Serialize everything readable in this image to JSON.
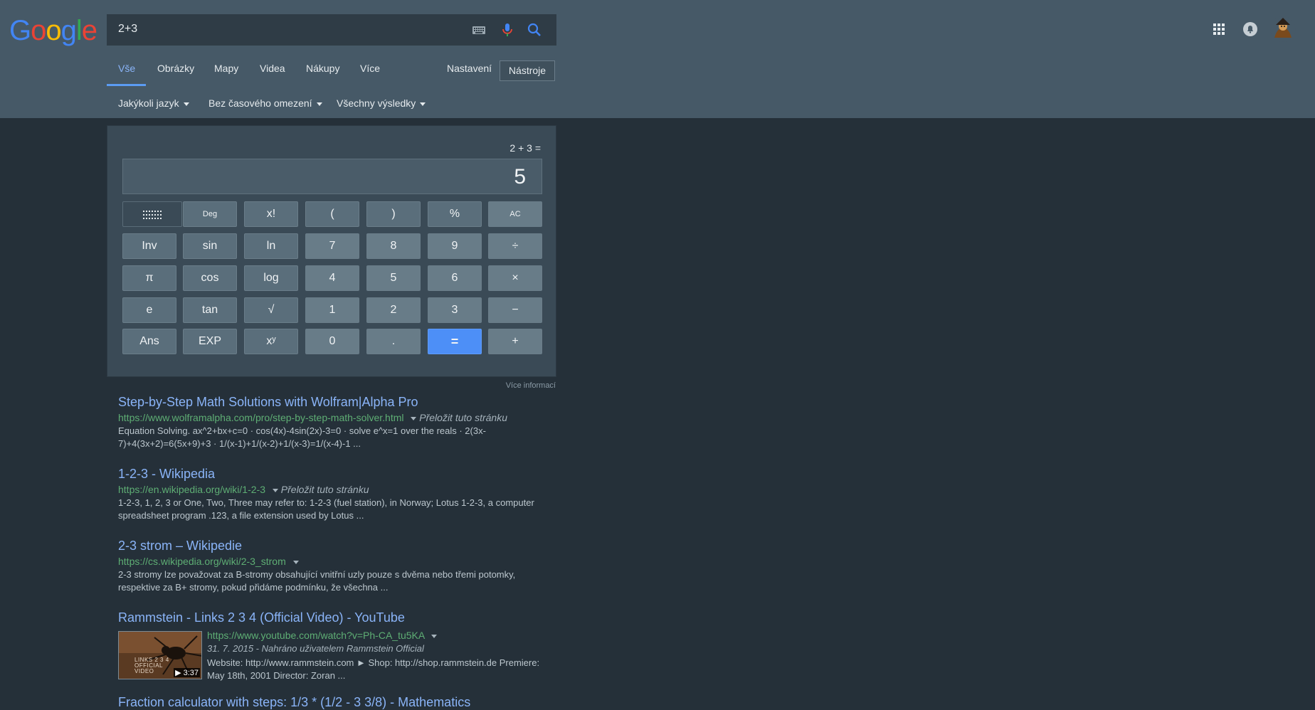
{
  "logo": {
    "g": "G",
    "o1": "o",
    "o2": "o",
    "g2": "g",
    "l": "l",
    "e": "e"
  },
  "search": {
    "query": "2+3"
  },
  "tabs": [
    "Vše",
    "Obrázky",
    "Mapy",
    "Videa",
    "Nákupy",
    "Více"
  ],
  "settings_label": "Nastavení",
  "tools_label": "Nástroje",
  "filters": [
    "Jakýkoli jazyk",
    "Bez časového omezení",
    "Všechny výsledky"
  ],
  "calculator": {
    "expression": "2 + 3 =",
    "result": "5",
    "mode_label": "Deg",
    "rows": [
      [
        "Deg",
        "x!",
        "(",
        ")",
        "%",
        "AC"
      ],
      [
        "Inv",
        "sin",
        "ln",
        "7",
        "8",
        "9",
        "÷"
      ],
      [
        "π",
        "cos",
        "log",
        "4",
        "5",
        "6",
        "×"
      ],
      [
        "e",
        "tan",
        "√",
        "1",
        "2",
        "3",
        "−"
      ],
      [
        "Ans",
        "EXP",
        "xʸ",
        "0",
        ".",
        "=",
        "+"
      ]
    ]
  },
  "more_info": "Více informací",
  "results": [
    {
      "title": "Step-by-Step Math Solutions with Wolfram|Alpha Pro",
      "url": "https://www.wolframalpha.com/pro/step-by-step-math-solver.html",
      "translate": "Přeložit tuto stránku",
      "snippet": "Equation Solving. ax^2+bx+c=0 · cos(4x)-4sin(2x)-3=0 · solve e^x=1 over the reals · 2(3x-7)+4(3x+2)=6(5x+9)+3 · 1/(x-1)+1/(x-2)+1/(x-3)=1/(x-4)-1 ..."
    },
    {
      "title": "1-2-3 - Wikipedia",
      "url": "https://en.wikipedia.org/wiki/1-2-3",
      "translate": "Přeložit tuto stránku",
      "snippet": "1-2-3, 1, 2, 3 or One, Two, Three may refer to: 1-2-3 (fuel station), in Norway; Lotus 1-2-3, a computer spreadsheet program .123, a file extension used by Lotus ..."
    },
    {
      "title": "2-3 strom – Wikipedie",
      "url": "https://cs.wikipedia.org/wiki/2-3_strom",
      "translate": "",
      "snippet": "2-3 stromy lze považovat za B-stromy obsahující vnitřní uzly pouze s dvěma nebo třemi potomky, respektive za B+ stromy, pokud přidáme podmínku, že všechna ..."
    },
    {
      "title": "Rammstein - Links 2 3 4 (Official Video) - YouTube",
      "url": "https://www.youtube.com/watch?v=Ph-CA_tu5KA",
      "date": "31. 7. 2015 - Nahráno uživatelem Rammstein Official",
      "snippet": "Website: http://www.rammstein.com ► Shop: http://shop.rammstein.de Premiere: May 18th, 2001 Director: Zoran ...",
      "duration": "3:37",
      "thumb_label": "LINKS 2 3 4 OFFICIAL VIDEO"
    },
    {
      "title": "Fraction calculator with steps: 1/3 * (1/2 - 3 3/8) - Mathematics"
    }
  ]
}
